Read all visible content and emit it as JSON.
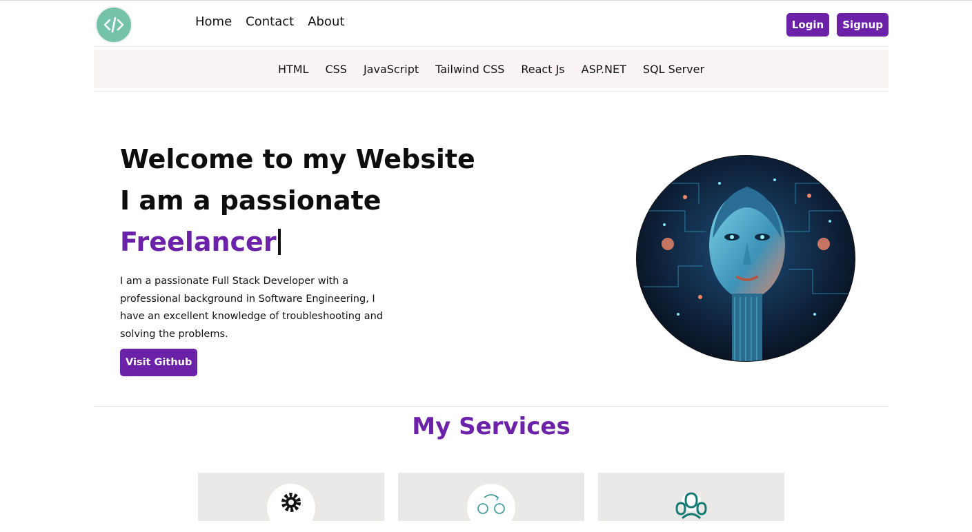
{
  "header": {
    "logo_icon": "code-brackets-icon",
    "nav": [
      "Home",
      "Contact",
      "About"
    ],
    "login_label": "Login",
    "signup_label": "Signup"
  },
  "subnav": [
    "HTML",
    "CSS",
    "JavaScript",
    "Tailwind CSS",
    "React Js",
    "ASP.NET",
    "SQL Server"
  ],
  "hero": {
    "line1": "Welcome to my Website",
    "line2": "I am a passionate",
    "role": "Freelancer",
    "description": "I am a passionate Full Stack Developer with a professional background in Software Engineering, I have an excellent knowledge of troubleshooting and solving the problems.",
    "github_label": "Visit Github",
    "image": "ai-face-portrait"
  },
  "services": {
    "title": "My Services",
    "cards": [
      {
        "icon": "gear-icon"
      },
      {
        "icon": "teamwork-icon"
      },
      {
        "icon": "users-group-icon"
      }
    ]
  },
  "colors": {
    "accent": "#6b21a8",
    "logo": "#73c2a9",
    "subnav_bg": "#f9f3f3",
    "card_bg": "#ebe9e7"
  }
}
